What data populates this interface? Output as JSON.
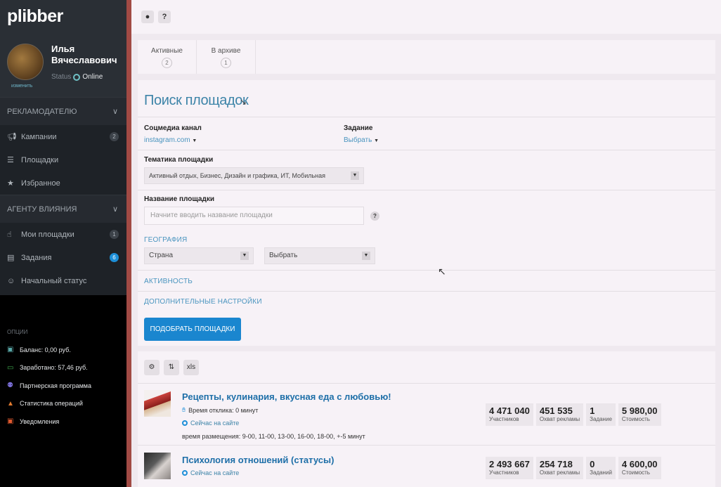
{
  "app": {
    "logo": "plibber"
  },
  "user": {
    "name": "Илья Вячеславович",
    "edit_label": "изменить",
    "status_label": "Status",
    "status_value": "Online"
  },
  "sidebar": {
    "advertiser_section": "РЕКЛАМОДАТЕЛЮ",
    "advertiser_items": [
      {
        "label": "Кампании",
        "badge": "2",
        "icon": "megaphone-icon"
      },
      {
        "label": "Площадки",
        "badge": "",
        "icon": "list-icon"
      },
      {
        "label": "Избранное",
        "badge": "",
        "icon": "star-icon"
      }
    ],
    "agent_section": "АГЕНТУ ВЛИЯНИЯ",
    "agent_items": [
      {
        "label": "Мои площадки",
        "badge": "1",
        "icon": "thumb-up-icon"
      },
      {
        "label": "Задания",
        "badge": "6",
        "icon": "document-icon"
      },
      {
        "label": "Начальный статус",
        "badge": "",
        "icon": "person-icon"
      }
    ],
    "options_title": "ОПЦИИ",
    "options": [
      {
        "label": "Баланс: 0,00 руб.",
        "icon": "wallet-icon",
        "color": "#5aa9a9"
      },
      {
        "label": "Заработано: 57,46 руб.",
        "icon": "money-icon",
        "color": "#3fae4f"
      },
      {
        "label": "Партнерская программа",
        "icon": "people-icon",
        "color": "#7a6ed6"
      },
      {
        "label": "Статистика операций",
        "icon": "bag-icon",
        "color": "#e07a2f"
      },
      {
        "label": "Уведомления",
        "icon": "tv-icon",
        "color": "#e05a2f"
      }
    ]
  },
  "toolbar": {
    "pin_icon": "pin-icon",
    "help_icon": "question-icon"
  },
  "tabs": [
    {
      "label": "Активные",
      "count": "2"
    },
    {
      "label": "В архиве",
      "count": "1"
    }
  ],
  "search": {
    "title": "Поиск площадок",
    "social_label": "Соцмедиа канал",
    "social_value": "instagram.com",
    "task_label": "Задание",
    "task_value": "Выбрать",
    "topic_label": "Тематика площадки",
    "topic_value": "Активный отдых, Бизнес, Дизайн и графика, ИТ, Мобильная",
    "name_label": "Название площадки",
    "name_placeholder": "Начните вводить название площадки",
    "geo_label": "ГЕОГРАФИЯ",
    "country_value": "Страна",
    "city_value": "Выбрать",
    "activity_label": "АКТИВНОСТЬ",
    "extra_label": "ДОПОЛНИТЕЛЬНЫЕ НАСТРОЙКИ",
    "submit_label": "ПОДОБРАТЬ ПЛОЩАДКИ"
  },
  "results_toolbar": {
    "settings_icon": "gear-icon",
    "sort_icon": "sort-icon",
    "xls_label": "xls"
  },
  "results": [
    {
      "title": "Рецепты, кулинария, вкусная еда с любовью!",
      "response_time": "Время отклика: 0 минут",
      "online": "Сейчас на сайте",
      "schedule": "время размещения: 9-00, 11-00, 13-00, 16-00, 18-00, +-5 минут",
      "stats": [
        {
          "value": "4 471 040",
          "label": "Участников"
        },
        {
          "value": "451 535",
          "label": "Охват рекламы"
        },
        {
          "value": "1",
          "label": "Задание"
        },
        {
          "value": "5 980,00",
          "label": "Стоимость"
        }
      ]
    },
    {
      "title": "Психология отношений (статусы)",
      "online": "Сейчас на сайте",
      "stats": [
        {
          "value": "2 493 667",
          "label": "Участников"
        },
        {
          "value": "254 718",
          "label": "Охват рекламы"
        },
        {
          "value": "0",
          "label": "Заданий"
        },
        {
          "value": "4 600,00",
          "label": "Стоимость"
        }
      ]
    }
  ]
}
